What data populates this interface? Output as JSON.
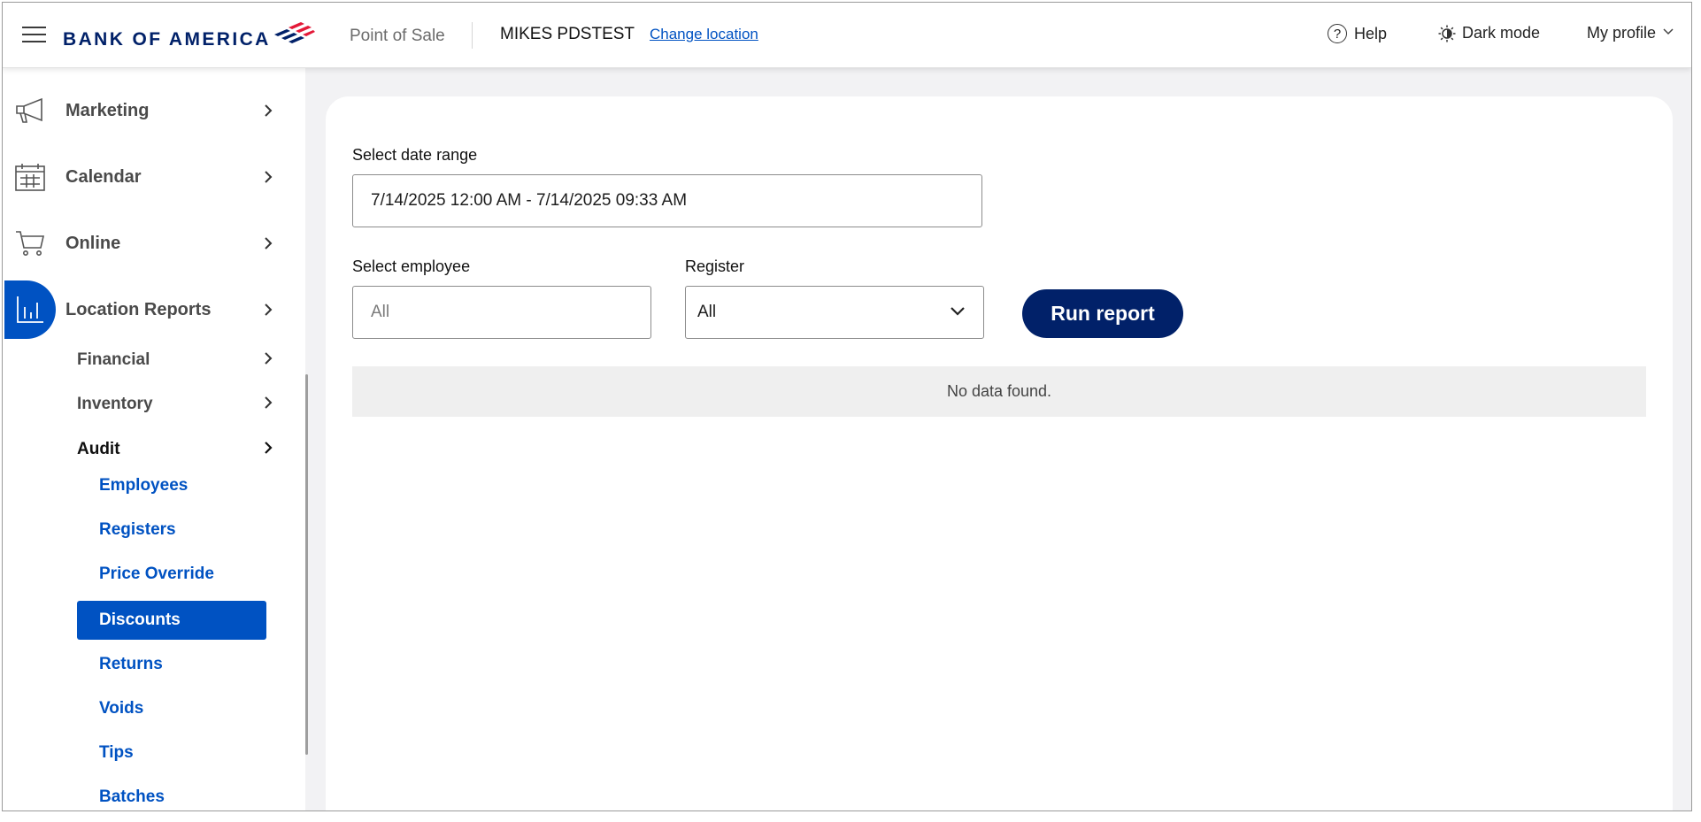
{
  "header": {
    "logo_text": "BANK OF AMERICA",
    "app_name": "Point of Sale",
    "location_name": "MIKES PDSTEST",
    "change_location": "Change location",
    "help": "Help",
    "dark_mode": "Dark mode",
    "profile": "My profile"
  },
  "sidebar": {
    "main_items": [
      {
        "label": "Marketing",
        "icon": "megaphone-icon"
      },
      {
        "label": "Calendar",
        "icon": "calendar-icon"
      },
      {
        "label": "Online",
        "icon": "cart-icon"
      },
      {
        "label": "Location Reports",
        "icon": "bar-chart-icon",
        "active": true
      }
    ],
    "sub_items": [
      {
        "label": "Financial"
      },
      {
        "label": "Inventory"
      },
      {
        "label": "Audit",
        "open": true
      }
    ],
    "audit_items": [
      {
        "label": "Employees"
      },
      {
        "label": "Registers"
      },
      {
        "label": "Price Override"
      },
      {
        "label": "Discounts",
        "active": true
      },
      {
        "label": "Returns"
      },
      {
        "label": "Voids"
      },
      {
        "label": "Tips"
      },
      {
        "label": "Batches"
      }
    ]
  },
  "report": {
    "date_range_label": "Select date range",
    "date_range_value": "7/14/2025 12:00 AM - 7/14/2025 09:33 AM",
    "employee_label": "Select employee",
    "employee_placeholder": "All",
    "register_label": "Register",
    "register_value": "All",
    "run_button": "Run report",
    "empty_message": "No data found."
  },
  "colors": {
    "brand_navy": "#012169",
    "brand_red": "#e31837",
    "accent_blue": "#0052c2"
  }
}
